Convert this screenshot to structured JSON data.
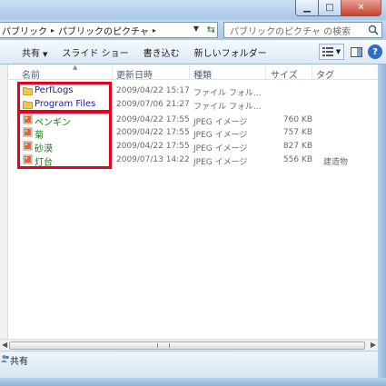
{
  "window": {
    "minimize_glyph": "▁",
    "maximize_glyph": "□",
    "close_glyph": "✕"
  },
  "address": {
    "crumbs": [
      "パブリック",
      "パブリックのピクチャ"
    ],
    "separator": "▸",
    "search_placeholder": "パブリックのピクチャ の検索"
  },
  "toolbar": {
    "share_label": "共有",
    "slideshow_label": "スライド ショー",
    "burn_label": "書き込む",
    "new_folder_label": "新しいフォルダー",
    "help_label": "?"
  },
  "columns": {
    "name": "名前",
    "date": "更新日時",
    "type": "種類",
    "size": "サイズ",
    "tag": "タグ"
  },
  "files": [
    {
      "name": "PerfLogs",
      "date": "2009/04/22 15:17",
      "type": "ファイル フォル...",
      "size": "",
      "tag": "",
      "kind": "folder"
    },
    {
      "name": "Program Files",
      "date": "2009/07/06 21:27",
      "type": "ファイル フォル...",
      "size": "",
      "tag": "",
      "kind": "folder"
    },
    {
      "name": "ペンギン",
      "date": "2009/04/22 17:55",
      "type": "JPEG イメージ",
      "size": "760 KB",
      "tag": "",
      "kind": "image"
    },
    {
      "name": "菊",
      "date": "2009/04/22 17:55",
      "type": "JPEG イメージ",
      "size": "757 KB",
      "tag": "",
      "kind": "image"
    },
    {
      "name": "砂漠",
      "date": "2009/04/22 17:55",
      "type": "JPEG イメージ",
      "size": "827 KB",
      "tag": "",
      "kind": "image"
    },
    {
      "name": "灯台",
      "date": "2009/07/13 14:22",
      "type": "JPEG イメージ",
      "size": "556 KB",
      "tag": "建造物",
      "kind": "image"
    }
  ],
  "details": {
    "status": "共有"
  },
  "colors": {
    "highlight": "#e8001c",
    "folder_text": "#1a1aa8",
    "image_text": "#1a7a1a"
  }
}
